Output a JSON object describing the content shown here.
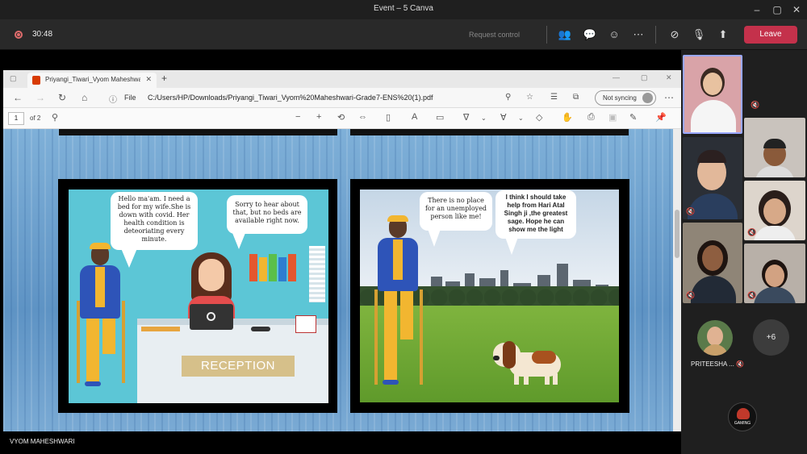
{
  "window": {
    "title": "Event – 5 Canva"
  },
  "meeting": {
    "timer": "30:48",
    "request_control": "Request control",
    "leave_label": "Leave",
    "colors": {
      "leave": "#c4314b",
      "recording": "#e06c6c"
    }
  },
  "browser": {
    "tab_title": "Priyangi_Tiwari_Vyom Maheshwari",
    "file_label": "File",
    "url": "C:/Users/HP/Downloads/Priyangi_Tiwari_Vyom%20Maheshwari-Grade7-ENS%20(1).pdf",
    "sync_label": "Not syncing"
  },
  "pdf": {
    "page_number": "1",
    "page_total": "of 2"
  },
  "comic": {
    "panel1": {
      "bubble_man": "Hello ma'am. I need a bed for my wife.She is down with covid. Her health condition is deteoriating every minute.",
      "bubble_woman": "Sorry to hear about that, but no beds are available right now.",
      "sign": "RECEPTION"
    },
    "panel2": {
      "bubble_left": "There is no place for an unemployed person like me!",
      "bubble_right": "I think I should take help from Hari Atal Singh ji ,the greatest sage. Hope he can show me the light"
    }
  },
  "presenter_name": "VYOM MAHESHWARI",
  "participants": {
    "featured_name": "PRITEESHA ...",
    "more_count": "+6",
    "badge_text": "GAMING"
  }
}
